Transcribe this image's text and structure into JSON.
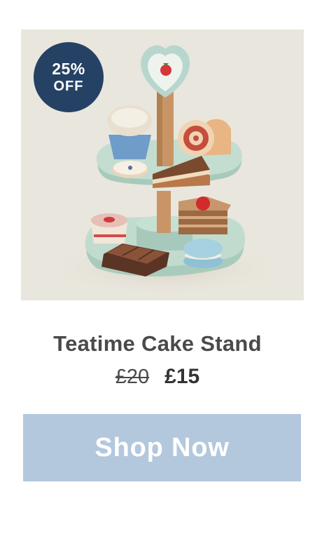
{
  "product": {
    "name": "Teatime Cake Stand",
    "original_price": "£20",
    "sale_price": "£15",
    "image_icon": "cake-stand-image"
  },
  "badge": {
    "percent": "25%",
    "label": "OFF",
    "color": "#254264"
  },
  "cta": {
    "label": "Shop Now",
    "color": "#b3c7dd"
  },
  "colors": {
    "image_background": "#e9e6dd",
    "title_text": "#4a4a4a"
  }
}
